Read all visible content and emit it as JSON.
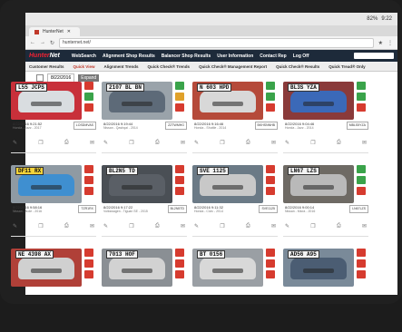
{
  "status": {
    "battery": "82%",
    "time": "9:22"
  },
  "browser": {
    "tab_title": "HunterNet",
    "url": "hunternet.net/"
  },
  "nav1": {
    "logo_prefix": "Hunter",
    "logo_suffix": "Net",
    "items": [
      "WebSearch",
      "Alignment Shop Results",
      "Balancer Shop Results",
      "User Information",
      "Contact Rep",
      "Log Off"
    ]
  },
  "nav2": {
    "items": [
      "Customer Results",
      "Quick View",
      "Alignment Trends",
      "Quick Check® Trends",
      "Quick Check® Management Report",
      "Quick Check® Results",
      "Quick Tread® Only"
    ],
    "active": 1
  },
  "toolbar": {
    "select_value": "8/22/2016",
    "expand_label": "Expand"
  },
  "cards": [
    {
      "plate": "L55 JCPS",
      "date": "8/22/2016 9:21:52",
      "vehicle": "Honda - Jazz - 2017",
      "box": "LOSDMVAS",
      "photo": "#c8303a",
      "car": "#d9dde0",
      "plate_bg": "#f3f3f3",
      "b1": "#d63b2f",
      "b2": "#3aa34a"
    },
    {
      "plate": "2107 BL BN",
      "date": "8/22/2016 9:19:44",
      "vehicle": "Nissan - Qashqai - 2014",
      "box": "ZZTWMHG",
      "photo": "#9aa3aa",
      "car": "#5d6a78",
      "plate_bg": "#f3f3f3",
      "b1": "#3aa34a",
      "b2": "#e0a12a"
    },
    {
      "plate": "N 603 HPD",
      "date": "8/22/2016 9:16:46",
      "vehicle": "Honda - Shuttle - 2014",
      "box": "BKHSNNHB",
      "photo": "#b54a3a",
      "car": "#d8d8d8",
      "plate_bg": "#f3f3f3",
      "b1": "#3aa34a",
      "b2": "#3aa34a"
    },
    {
      "plate": "BL3S YZA",
      "date": "8/22/2016 9:04:46",
      "vehicle": "Honda - Jazz - 2014",
      "box": "MBLS5YZA",
      "photo": "#8a3a3a",
      "car": "#3b69b8",
      "plate_bg": "#f3f3f3",
      "b1": "#3aa34a",
      "b2": "#3aa34a"
    },
    {
      "plate": "DF11 RX",
      "date": "8/22/2016 9:58:16",
      "vehicle": "Nissan - Note - 2016",
      "box": "TZR1RX",
      "photo": "#8f9aa3",
      "car": "#3f8fd0",
      "plate_bg": "#f3d33a",
      "b1": "#d63b2f",
      "b2": "#d63b2f"
    },
    {
      "plate": "BL2N5 TD",
      "date": "8/22/2016 9:17:22",
      "vehicle": "Volkswagen - Tiguan SE - 2015",
      "box": "BL2N5TD",
      "photo": "#4a4f55",
      "car": "#5a5f66",
      "plate_bg": "#f3f3f3",
      "b1": "#d63b2f",
      "b2": "#d63b2f"
    },
    {
      "plate": "SVE 1125",
      "date": "8/22/2016 9:11:32",
      "vehicle": "Honda - Civic - 2014",
      "box": "SVE1125",
      "photo": "#6b7a86",
      "car": "#c8c8c8",
      "plate_bg": "#f3f3f3",
      "b1": "#d63b2f",
      "b2": "#d63b2f"
    },
    {
      "plate": "LN67 LZS",
      "date": "8/22/2016 9:00:14",
      "vehicle": "Nissan - Micra - 2016",
      "box": "LN67LZS",
      "photo": "#6e6a64",
      "car": "#b9b9b9",
      "plate_bg": "#f3f3f3",
      "b1": "#3aa34a",
      "b2": "#3aa34a"
    },
    {
      "plate": "NE 4398 AX",
      "date": "",
      "vehicle": "",
      "box": "",
      "photo": "#b04038",
      "car": "#d0d0d0",
      "plate_bg": "#f3f3f3",
      "b1": "#d63b2f",
      "b2": "#d63b2f"
    },
    {
      "plate": "7013 HOF",
      "date": "",
      "vehicle": "",
      "box": "",
      "photo": "#8a8f94",
      "car": "#d2d2d2",
      "plate_bg": "#f3f3f3",
      "b1": "#d63b2f",
      "b2": "#d63b2f"
    },
    {
      "plate": "BT 0156",
      "date": "",
      "vehicle": "",
      "box": "",
      "photo": "#9a9fa4",
      "car": "#d8d8d8",
      "plate_bg": "#f3f3f3",
      "b1": "#d63b2f",
      "b2": "#d63b2f"
    },
    {
      "plate": "AD56 A95",
      "date": "",
      "vehicle": "",
      "box": "",
      "photo": "#7a8a99",
      "car": "#4b5d73",
      "plate_bg": "#f3f3f3",
      "b1": "#d63b2f",
      "b2": "#d63b2f"
    }
  ]
}
